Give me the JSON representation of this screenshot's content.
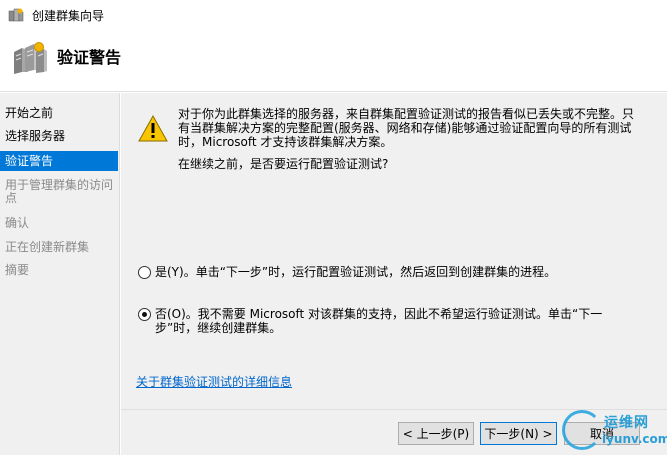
{
  "window": {
    "title": "创建群集向导"
  },
  "header": {
    "title": "验证警告",
    "icon": "cluster-servers-icon"
  },
  "nav": {
    "items": [
      {
        "label": "开始之前",
        "state": "done"
      },
      {
        "label": "选择服务器",
        "state": "done"
      },
      {
        "label": "验证警告",
        "state": "active"
      },
      {
        "label": "用于管理群集的访问点",
        "state": "pending"
      },
      {
        "label": "确认",
        "state": "pending"
      },
      {
        "label": "正在创建新群集",
        "state": "pending"
      },
      {
        "label": "摘要",
        "state": "pending"
      }
    ]
  },
  "content": {
    "warning_icon": "warning-triangle-icon",
    "message": "对于你为此群集选择的服务器，来自群集配置验证测试的报告看似已丢失或不完整。只有当群集解决方案的完整配置(服务器、网络和存储)能够通过验证配置向导的所有测试时，Microsoft 才支持该群集解决方案。",
    "question": "在继续之前，是否要运行配置验证测试?",
    "options": [
      {
        "label": "是(Y)。单击“下一步”时，运行配置验证测试，然后返回到创建群集的进程。",
        "checked": false
      },
      {
        "label": "否(O)。我不需要 Microsoft 对该群集的支持，因此不希望运行验证测试。单击“下一步”时，继续创建群集。",
        "checked": true
      }
    ],
    "link": "关于群集验证测试的详细信息"
  },
  "footer": {
    "back_label": "< 上一步(P)",
    "next_label": "下一步(N) >",
    "cancel_label": "取消"
  },
  "watermark": {
    "cn": "运维网",
    "en": "iyunv.com"
  },
  "colors": {
    "accent": "#0078d7",
    "link": "#0066cc",
    "panel": "#f0f0f0"
  }
}
